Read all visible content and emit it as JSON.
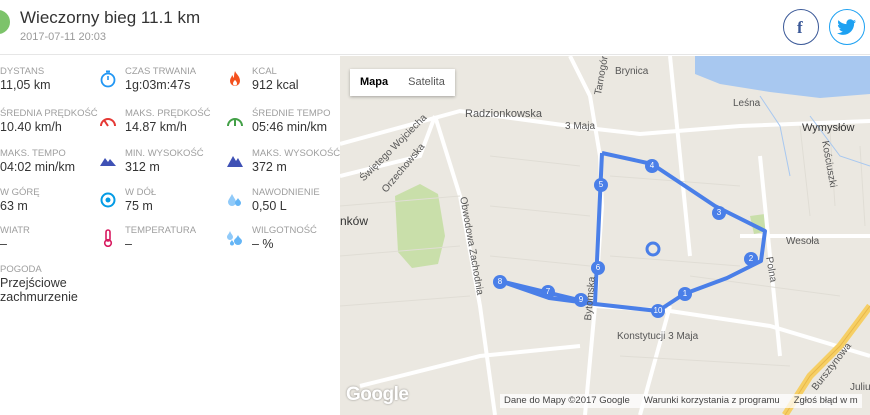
{
  "header": {
    "title": "Wieczorny bieg 11.1 km",
    "datetime": "2017-07-11 20:03",
    "share_facebook_icon": "facebook-icon",
    "share_twitter_icon": "twitter-icon"
  },
  "stats": [
    {
      "label": "DYSTANS",
      "value": "11,05 km",
      "icon": "distance-icon",
      "color": "#9e9e9e"
    },
    {
      "label": "CZAS TRWANIA",
      "value": "1g:03m:47s",
      "icon": "stopwatch-icon",
      "color": "#2196f3"
    },
    {
      "label": "KCAL",
      "value": "912 kcal",
      "icon": "flame-icon",
      "color": "#f4511e"
    },
    {
      "label": "ŚREDNIA PRĘDKOŚĆ",
      "value": "10.40 km/h",
      "icon": "speed-icon",
      "color": "#9e9e9e"
    },
    {
      "label": "MAKS. PRĘDKOŚĆ",
      "value": "14.87 km/h",
      "icon": "max-speed-icon",
      "color": "#e53935"
    },
    {
      "label": "ŚREDNIE TEMPO",
      "value": "05:46 min/km",
      "icon": "pace-icon",
      "color": "#43a047"
    },
    {
      "label": "MAKS. TEMPO",
      "value": "04:02 min/km",
      "icon": "max-pace-icon",
      "color": "#9e9e9e"
    },
    {
      "label": "MIN. WYSOKOŚĆ",
      "value": "312 m",
      "icon": "mountain-icon",
      "color": "#3f51b5"
    },
    {
      "label": "MAKS. WYSOKOŚĆ",
      "value": "372 m",
      "icon": "mountain-icon",
      "color": "#3f51b5"
    },
    {
      "label": "W GÓRĘ",
      "value": "63 m",
      "icon": "ascent-icon",
      "color": "#9e9e9e"
    },
    {
      "label": "W DÓŁ",
      "value": "75 m",
      "icon": "descent-icon",
      "color": "#039be5"
    },
    {
      "label": "NAWODNIENIE",
      "value": "0,50 L",
      "icon": "water-drops-icon",
      "color": "#64b5f6"
    },
    {
      "label": "WIATR",
      "value": "–",
      "icon": "wind-icon",
      "color": "#9e9e9e"
    },
    {
      "label": "TEMPERATURA",
      "value": "–",
      "icon": "thermometer-icon",
      "color": "#d81b60"
    },
    {
      "label": "WILGOTNOŚĆ",
      "value": "– %",
      "icon": "humidity-icon",
      "color": "#64b5f6"
    },
    {
      "label": "POGODA",
      "value": "Przejściowe zachmurzenie",
      "icon": "weather-icon",
      "color": "#9e9e9e"
    }
  ],
  "map": {
    "toggle_map": "Mapa",
    "toggle_satellite": "Satelita",
    "labels": {
      "brynica": "Brynica",
      "radzionkowska": "Radzionkowska",
      "trzeciego_maja": "3 Maja",
      "tarnogorska": "Tarnogórska",
      "lesna": "Leśna",
      "wymyslow": "Wymysłów",
      "kosciuszki": "Kościuszki",
      "wesola": "Wesoła",
      "polna": "Polna",
      "swietego_wojciecha": "Świętego Wojciecha",
      "orzechowska": "Orzechowska",
      "nkow": "nków",
      "obwodowa": "Obwodowa Zachodnia",
      "bytomska": "Bytomska",
      "konstytucji": "Konstytucji 3 Maja",
      "bursztynowa": "Bursztynowa",
      "juliu": "Juliu"
    },
    "route_markers": [
      "2",
      "3",
      "4",
      "5",
      "6",
      "7",
      "8",
      "9",
      "10",
      "1"
    ],
    "google_logo": "Google",
    "attribution": {
      "data": "Dane do Mapy ©2017 Google",
      "terms": "Warunki korzystania z programu",
      "report": "Zgłoś błąd w m"
    },
    "route_color": "#4a7fe8"
  }
}
